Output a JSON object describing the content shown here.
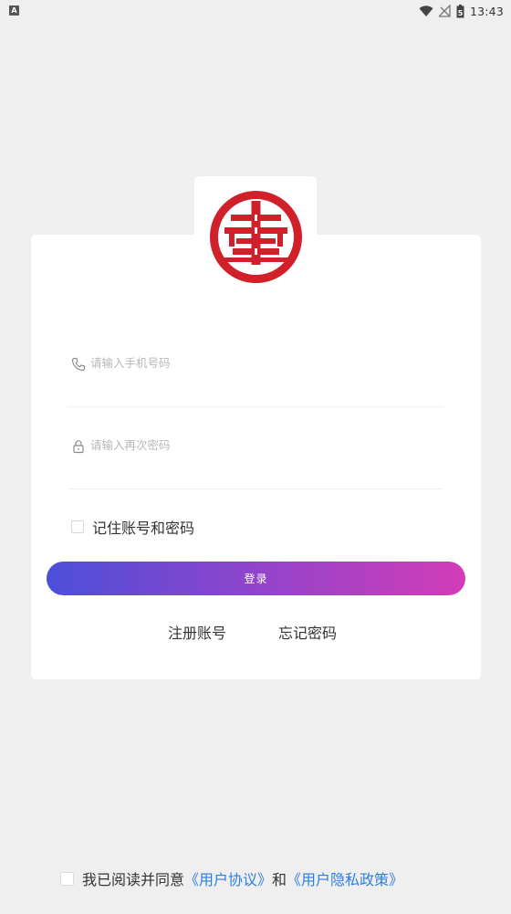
{
  "status_bar": {
    "app_icon_letter": "A",
    "time": "13:43",
    "battery_glyph": "5"
  },
  "login": {
    "phone_placeholder": "请输入手机号码",
    "password_placeholder": "请输入再次密码",
    "remember_label": "记住账号和密码",
    "login_button": "登录",
    "register_link": "注册账号",
    "forgot_link": "忘记密码"
  },
  "agreement": {
    "prefix": "我已阅读并同意",
    "user_agreement": "《用户协议》",
    "connector": "和",
    "privacy_policy": "《用户隐私政策》"
  },
  "colors": {
    "background": "#efeff0",
    "logo_red": "#d0202a",
    "link_blue": "#2f7fd8",
    "button_gradient_start": "#4c4fd8",
    "button_gradient_end": "#d33cb8"
  },
  "icons": {
    "phone": "phone-icon",
    "lock": "lock-icon",
    "wifi": "wifi-icon",
    "signal": "signal-icon",
    "battery": "battery-icon"
  }
}
